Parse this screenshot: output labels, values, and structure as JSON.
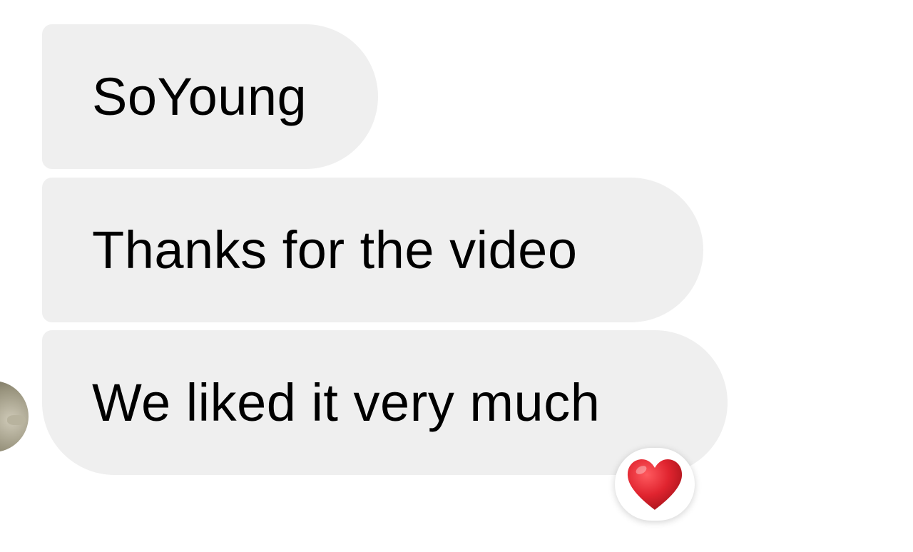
{
  "conversation": {
    "messages": [
      {
        "text": "SoYoung"
      },
      {
        "text": "Thanks for the video"
      },
      {
        "text": "We liked it very much"
      }
    ],
    "reaction": {
      "icon": "red-heart-icon",
      "color": "#e0242f"
    },
    "sender_avatar": {
      "icon": "avatar"
    },
    "bubble_color": "#efefef"
  }
}
